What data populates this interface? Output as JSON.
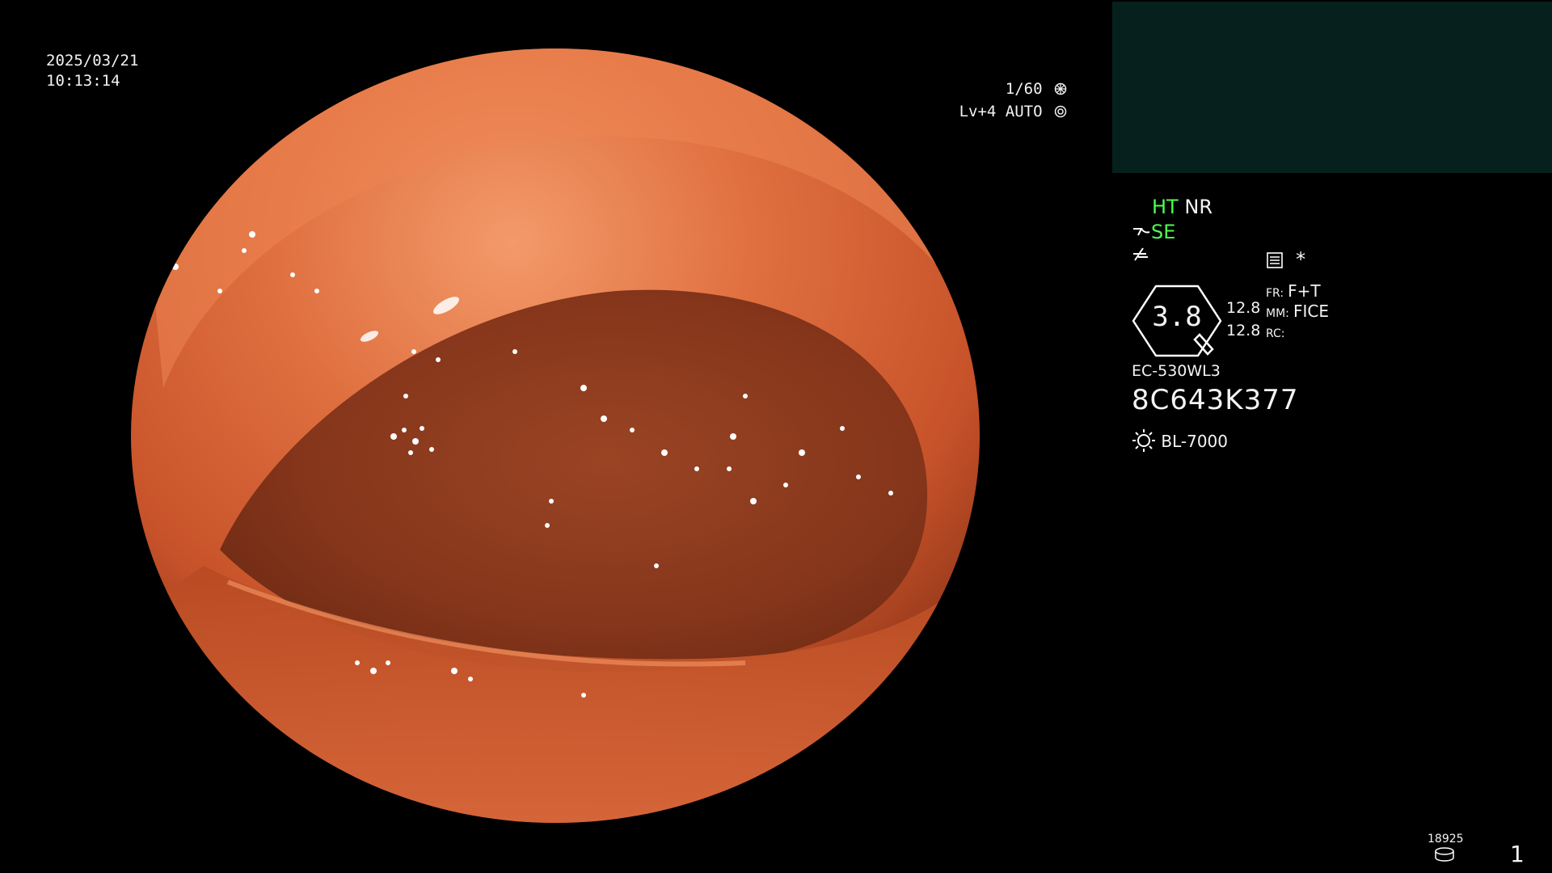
{
  "date": "2025/03/21",
  "time": "10:13:14",
  "shutter": "1/60",
  "level": "Lv+4",
  "iris_mode": "AUTO",
  "mode_ht": "HT",
  "mode_nr": "NR",
  "mode_se": "SE",
  "asterisk": "*",
  "lens_value": "3.8",
  "value_top": "12.8",
  "value_bottom": "12.8",
  "fr_label": "FR:",
  "fr_value": "F+T",
  "mm_label": "MM:",
  "mm_value": "FICE",
  "rc_label": "RC:",
  "scope_model": "EC-530WL3",
  "serial": "8C643K377",
  "light_source": "BL-7000",
  "image_count": "18925",
  "page_number": "1",
  "colors": {
    "mode_green": "#4dff4d",
    "panel": "#06201d",
    "background": "#000000"
  },
  "icons": [
    "shutter-wheel-icon",
    "iris-auto-icon",
    "structure-enhance-icon",
    "color-enhance-icon",
    "menu-list-icon",
    "lens-badge-icon",
    "light-sun-icon",
    "storage-disk-icon"
  ]
}
